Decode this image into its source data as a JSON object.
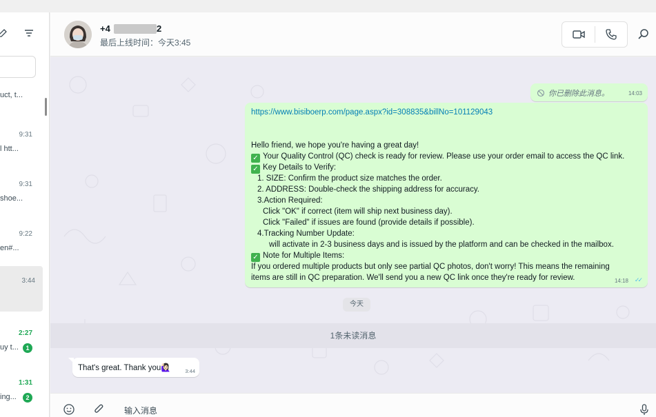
{
  "sidebar": {
    "icons": [
      "new-chat-icon",
      "filter-icon"
    ],
    "chats": [
      {
        "preview": "uct, t...",
        "time": "",
        "unread": false,
        "badge": ""
      },
      {
        "preview": "l htt...",
        "time": "9:31",
        "unread": false,
        "badge": ""
      },
      {
        "preview": "shoe...",
        "time": "9:31",
        "unread": false,
        "badge": ""
      },
      {
        "preview": "en#...",
        "time": "9:22",
        "unread": false,
        "badge": ""
      },
      {
        "preview": "",
        "time": "3:44",
        "unread": false,
        "badge": ""
      },
      {
        "preview": "uy t...",
        "time": "2:27",
        "unread": true,
        "badge": "1"
      },
      {
        "preview": "ing...",
        "time": "1:31",
        "unread": true,
        "badge": "2"
      }
    ]
  },
  "header": {
    "name_prefix": "+4",
    "name_suffix": "2",
    "last_seen": "最后上线时间：今天3:45",
    "icons": [
      "video-call-icon",
      "voice-call-icon",
      "search-icon"
    ]
  },
  "messages": {
    "deleted": {
      "text": "你已删除此消息。",
      "time": "14:03"
    },
    "main": {
      "link": "https://www.bisiboerp.com/page.aspx?id=308835&billNo=101129043",
      "lines": [
        {
          "text": "Hello friend, we hope you're having a great day!",
          "check": false,
          "indent": 0
        },
        {
          "text": "Your Quality Control (QC) check is ready for review. Please use your order email to access the QC link.",
          "check": true,
          "indent": 0
        },
        {
          "text": "Key Details to Verify:",
          "check": true,
          "indent": 0
        },
        {
          "text": "1. SIZE: Confirm the product size matches the order.",
          "check": false,
          "indent": 1
        },
        {
          "text": "2. ADDRESS: Double-check the shipping address for accuracy.",
          "check": false,
          "indent": 1
        },
        {
          "text": "3.Action Required:",
          "check": false,
          "indent": 1
        },
        {
          "text": "Click \"OK\" if correct (item will ship next business day).",
          "check": false,
          "indent": 2
        },
        {
          "text": "Click \"Failed\" if issues are found (provide details if possible).",
          "check": false,
          "indent": 2
        },
        {
          "text": "4.Tracking Number Update:",
          "check": false,
          "indent": 1
        },
        {
          "text": "will activate in 2-3 business days and is issued by the platform and can be checked in the mailbox.",
          "check": false,
          "indent": 3
        },
        {
          "text": "Note for Multiple Items:",
          "check": true,
          "indent": 0
        },
        {
          "text": "If you ordered multiple products but only see partial QC photos, don't worry! This means the remaining",
          "check": false,
          "indent": 0
        },
        {
          "text": "items are still in QC preparation. We'll send you a new QC link once they're ready for review.",
          "check": false,
          "indent": 0
        }
      ],
      "time": "14:18",
      "status": "read"
    },
    "date_divider": "今天",
    "unread_divider": "1条未读消息",
    "received": {
      "text": "That's great. Thank you🙋🏻‍♀️",
      "time": "3:44"
    }
  },
  "composer": {
    "placeholder": "输入消息",
    "icons": [
      "emoji-icon",
      "attach-icon",
      "microphone-icon"
    ]
  },
  "colors": {
    "outgoing_bubble": "#d9fdd3",
    "incoming_bubble": "#ffffff",
    "chat_background": "#ecebf3",
    "unread_green": "#1fa855",
    "link": "#027eb5"
  }
}
